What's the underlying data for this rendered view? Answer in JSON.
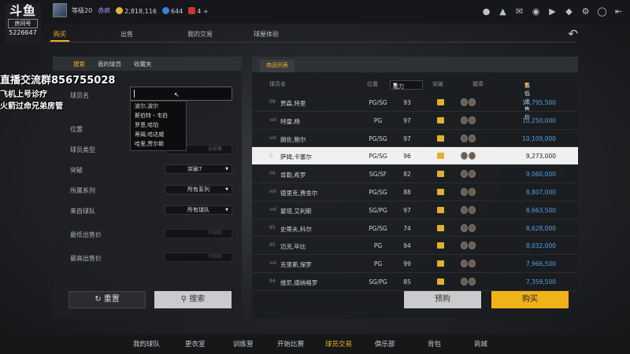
{
  "logo": {
    "brand": "斗鱼",
    "room_label": "房间号",
    "room_no": "5226647"
  },
  "user": {
    "level": "等级20",
    "vip_name": "赤疯",
    "coins": "2,818,116",
    "gems": "644",
    "tickets": "4",
    "plus": "+"
  },
  "top_icons": [
    "person-icon",
    "bell-icon",
    "mail-icon",
    "group-icon",
    "video-icon",
    "shield-icon",
    "gear-icon",
    "headset-icon",
    "exit-icon"
  ],
  "nav": {
    "tabs": [
      "购买",
      "出售",
      "我的交易",
      "球屋体验"
    ],
    "active": "购买"
  },
  "overlay": {
    "line1": "直播交流群856755028",
    "line2": "飞机上号诊疗",
    "line3": "火箭过命兄弟房管"
  },
  "filter": {
    "tabs": [
      "搜索",
      "我的球员",
      "收藏夹"
    ],
    "labels": {
      "name": "球员名",
      "position": "位置",
      "type": "球员类型",
      "breakthrough": "突破",
      "series": "所属系列",
      "team": "来自球队",
      "min_price": "最低出售价",
      "max_price": "最高出售价"
    },
    "type_partial": "全部类",
    "breakthrough_value": "突破7",
    "series_value": "所有系列",
    "team_value": "所有球队",
    "min_price_ph": "不限制",
    "max_price_ph": "不限制",
    "dropdown": [
      "波尔,波尔",
      "斯伯特・韦伯",
      "罗恩,哈珀",
      "蒂姆,哈达威",
      "哈里,贾尔斯"
    ],
    "reset": "重置",
    "search": "搜索"
  },
  "market": {
    "tab": "商品列表",
    "columns": {
      "name": "球员名",
      "position": "位置",
      "ability": "能力",
      "breakthrough": "突破",
      "skill": "徽章",
      "price": "最低出售价"
    },
    "rows": [
      {
        "num": "09",
        "name": "贾森,特里",
        "pos": "PG/SG",
        "abil": "93",
        "price": "10,795,500"
      },
      {
        "num": "vol",
        "name": "特雷,杨",
        "pos": "PG",
        "abil": "97",
        "price": "10,250,000"
      },
      {
        "num": "vol",
        "name": "朗佐,鲍尔",
        "pos": "PG/SG",
        "abil": "97",
        "price": "10,109,000"
      },
      {
        "num": "◇",
        "name": "萨姆,卡塞尔",
        "pos": "PG/SG",
        "abil": "96",
        "price": "9,273,000",
        "selected": true
      },
      {
        "num": "09",
        "name": "肯勒,希罗",
        "pos": "SG/SF",
        "abil": "82",
        "price": "9,060,000"
      },
      {
        "num": "vol",
        "name": "德里克,费舍尔",
        "pos": "PG/SG",
        "abil": "88",
        "price": "8,807,000"
      },
      {
        "num": "vol",
        "name": "蒙塔,艾利斯",
        "pos": "SG/PG",
        "abil": "97",
        "price": "8,663,500"
      },
      {
        "num": "95",
        "name": "史蒂夫,科尔",
        "pos": "PG/SG",
        "abil": "74",
        "price": "8,628,000"
      },
      {
        "num": "95",
        "name": "迈克,毕比",
        "pos": "PG",
        "abil": "94",
        "price": "8,032,000"
      },
      {
        "num": "vol",
        "name": "克里斯,保罗",
        "pos": "PG",
        "abil": "99",
        "price": "7,966,500"
      },
      {
        "num": "94",
        "name": "维尼,德纳格罗",
        "pos": "SG/PG",
        "abil": "85",
        "price": "7,359,500"
      }
    ],
    "preorder": "预购",
    "buy": "购买"
  },
  "bottom_nav": {
    "items": [
      "我的球队",
      "更衣室",
      "训练营",
      "开始比赛",
      "球员交易",
      "俱乐部",
      "背包",
      "商城"
    ],
    "active": "球员交易"
  },
  "colors": {
    "accent": "#f0b21b",
    "price": "#4fa3e6"
  }
}
